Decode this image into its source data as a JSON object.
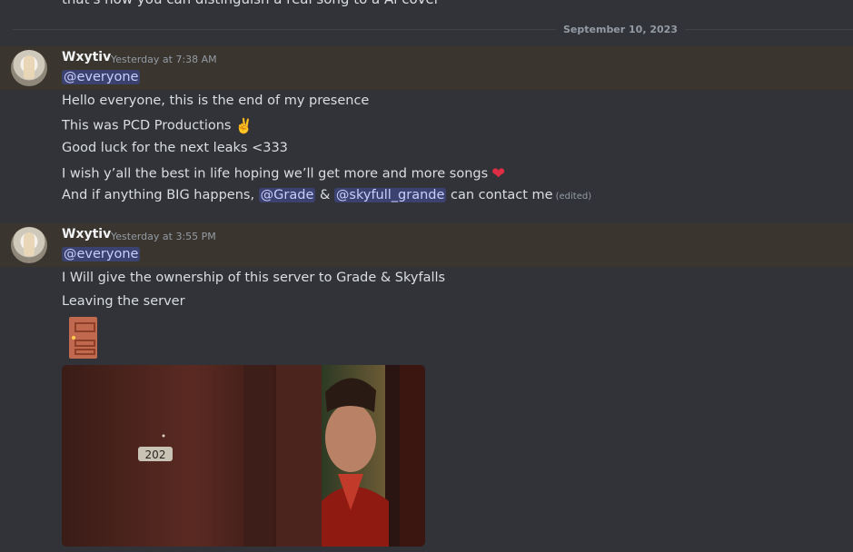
{
  "top_message": {
    "text": "that's how you can distinguish a real song to a Ai cover"
  },
  "date_divider": {
    "label": "September 10, 2023"
  },
  "messages": [
    {
      "author": "Wxytiv",
      "timestamp": "Yesterday at 7:38 AM",
      "mention": "@everyone",
      "lines": [
        {
          "text": "Hello everyone, this is the end of my presence"
        },
        {
          "text": "This was PCD Productions",
          "emoji": "✌️"
        },
        {
          "text": "Good luck for the next leaks <333"
        },
        {
          "text": "I wish y’all the best in life hoping we’ll get more and more songs",
          "emoji": "❤"
        }
      ],
      "last_line": {
        "prefix": "And if anything BIG happens, ",
        "mention1": "@Grade",
        "joiner": " & ",
        "mention2": "@skyfull_grande",
        "suffix": " can contact me",
        "edited": "(edited)"
      }
    },
    {
      "author": "Wxytiv",
      "timestamp": "Yesterday at 3:55 PM",
      "mention": "@everyone",
      "lines": [
        {
          "text": "I Will give the ownership of this server to Grade & Skyfalls"
        },
        {
          "text": "Leaving the server"
        }
      ],
      "attachment": {
        "door_emoji": "door-emoji",
        "gif_room_number": "202"
      }
    }
  ],
  "colors": {
    "background": "#313338",
    "mention_highlight_band": "#3a362f",
    "mention_pill": "#3c4270",
    "mention_text": "#c9cdfb",
    "muted": "#949ba4"
  }
}
